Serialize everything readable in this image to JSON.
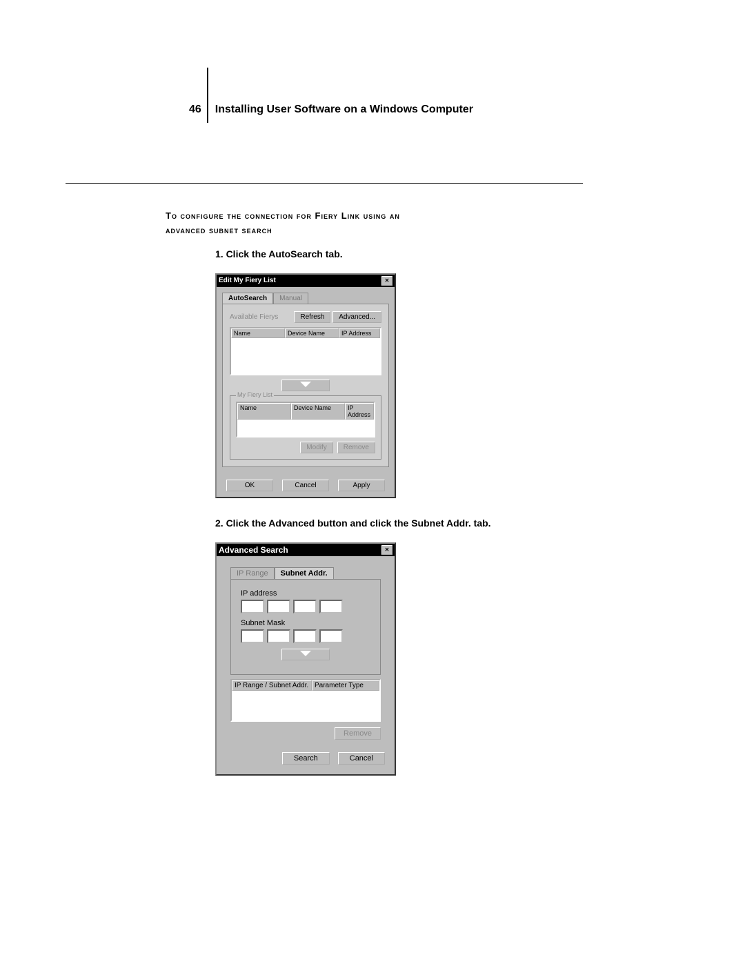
{
  "page_number": "46",
  "chapter_title": "Installing User Software on a Windows Computer",
  "heading_line1": "To configure the connection for Fiery Link using an",
  "heading_line2": "advanced subnet search",
  "step1": "1.   Click the AutoSearch tab.",
  "step2": "2.   Click the Advanced button and click the Subnet Addr. tab.",
  "dlg1": {
    "title": "Edit My Fiery List",
    "tab_autosearch": "AutoSearch",
    "tab_manual": "Manual",
    "available": "Available Fierys",
    "refresh": "Refresh",
    "advanced": "Advanced...",
    "col_name": "Name",
    "col_device": "Device Name",
    "col_ip": "IP Address",
    "my_list": "My Fiery List",
    "modify": "Modify",
    "remove": "Remove",
    "ok": "OK",
    "cancel": "Cancel",
    "apply": "Apply"
  },
  "dlg2": {
    "title": "Advanced Search",
    "tab_iprange": "IP Range",
    "tab_subnet": "Subnet Addr.",
    "ip_address": "IP address",
    "subnet_mask": "Subnet Mask",
    "col_range": "IP Range / Subnet Addr.",
    "col_param": "Parameter Type",
    "remove": "Remove",
    "search": "Search",
    "cancel": "Cancel"
  }
}
